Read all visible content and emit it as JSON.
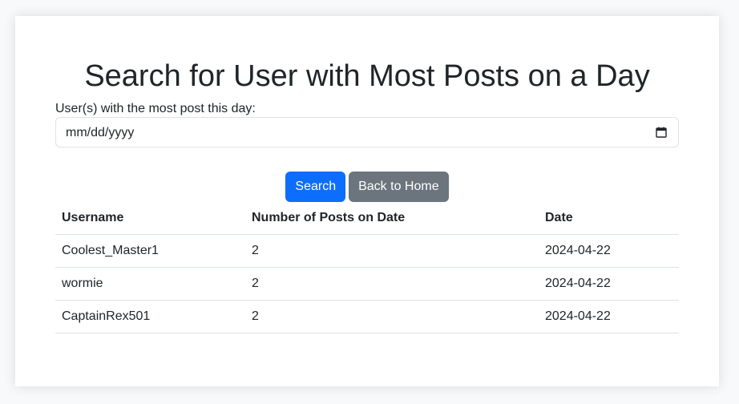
{
  "page": {
    "title": "Search for User with Most Posts on a Day",
    "date_label": "User(s) with the most post this day:",
    "date_placeholder": "mm/dd/yyyy"
  },
  "buttons": {
    "search": "Search",
    "back_home": "Back to Home"
  },
  "table": {
    "headers": [
      "Username",
      "Number of Posts on Date",
      "Date"
    ],
    "rows": [
      [
        "Coolest_Master1",
        "2",
        "2024-04-22"
      ],
      [
        "wormie",
        "2",
        "2024-04-22"
      ],
      [
        "CaptainRex501",
        "2",
        "2024-04-22"
      ]
    ]
  },
  "colors": {
    "primary": "#0d6efd",
    "secondary": "#6c757d",
    "border": "#dee2e6"
  },
  "icons": {
    "date_picker": "calendar-icon"
  }
}
